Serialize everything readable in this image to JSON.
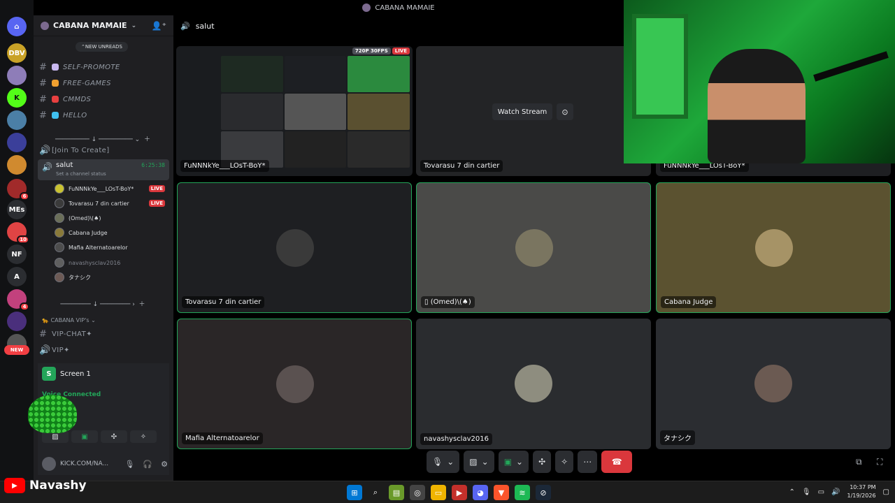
{
  "window": {
    "title": "CABANA MAMAIE",
    "title_icon": "server-avatar"
  },
  "rail": {
    "items": [
      {
        "name": "discord-home",
        "text": "⌂",
        "color": "#5865f2",
        "badge": ""
      },
      {
        "name": "server-dbv",
        "text": "DBV",
        "color": "#c9a227",
        "badge": ""
      },
      {
        "name": "server-anime",
        "text": "",
        "color": "#8e7db8",
        "badge": ""
      },
      {
        "name": "server-kick",
        "text": "K",
        "color": "#53fc18",
        "badge": ""
      },
      {
        "name": "server-globe",
        "text": "",
        "color": "#4b7fa6",
        "badge": ""
      },
      {
        "name": "server-drop",
        "text": "",
        "color": "#3b3f9a",
        "badge": ""
      },
      {
        "name": "server-char",
        "text": "",
        "color": "#d08a2f",
        "badge": ""
      },
      {
        "name": "server-red",
        "text": "",
        "color": "#a12a2a",
        "badge": "6"
      },
      {
        "name": "server-mes",
        "text": "MEs",
        "color": "#2b2d31",
        "badge": ""
      },
      {
        "name": "server-cs",
        "text": "",
        "color": "#e04444",
        "badge": "10"
      },
      {
        "name": "server-nf",
        "text": "NF",
        "color": "#2b2d31",
        "badge": ""
      },
      {
        "name": "server-a",
        "text": "A",
        "color": "#2b2d31",
        "badge": ""
      },
      {
        "name": "server-pink",
        "text": "",
        "color": "#c2417d",
        "badge": "4"
      },
      {
        "name": "server-purple",
        "text": "",
        "color": "#4a2f7c",
        "badge": ""
      },
      {
        "name": "server-last",
        "text": "",
        "color": "#555",
        "badge": ""
      }
    ],
    "new_label": "NEW"
  },
  "sidebar": {
    "guild_name": "CABANA MAMAIE",
    "unreads_label": "NEW UNREADS",
    "channels": [
      {
        "name": "SELF-PROMOTE",
        "color": "#c9b8f0"
      },
      {
        "name": "FREE-GAMES",
        "color": "#f0a030"
      },
      {
        "name": "CMMDS",
        "color": "#e84040"
      },
      {
        "name": "HELLO",
        "color": "#40c0f0"
      }
    ],
    "join_to_create": "[Join To Create]",
    "voice_channel": {
      "name": "salut",
      "time": "6:25:38",
      "status": "Set a channel status"
    },
    "members": [
      {
        "name": "FuNNNkYe___LOsT-BoY*",
        "live": "LIVE",
        "avatar": "#c9c230",
        "dim": false
      },
      {
        "name": "Tovarasu 7 din cartier",
        "live": "LIVE",
        "avatar": "#3b3b3b",
        "dim": false
      },
      {
        "name": "(Omed)\\(♠)",
        "live": "",
        "avatar": "#6b6f59",
        "dim": false
      },
      {
        "name": "Cabana Judge",
        "live": "",
        "avatar": "#8a7a3a",
        "dim": false
      },
      {
        "name": "Mafia Alternatoarelor",
        "live": "",
        "avatar": "#4d4d4d",
        "dim": false
      },
      {
        "name": "navashysclav2016",
        "live": "",
        "avatar": "#5f5f5f",
        "dim": true
      },
      {
        "name": "タナシク",
        "live": "",
        "avatar": "#6d5a55",
        "dim": false
      }
    ],
    "category": "CABANA VIP's",
    "vip_channels": [
      "VIP-CHAT✦",
      "VIP✦"
    ]
  },
  "user_panel": {
    "screen_label": "Screen 1",
    "voice_connected": "Voice Connected",
    "username": "KICK.COM/NA..."
  },
  "main": {
    "channel_name": "salut",
    "quality": "720P 30FPS",
    "live": "LIVE",
    "watch_stream": "Watch Stream",
    "tiles": [
      {
        "label": "FuNNNkYe___LOsT-BoY*",
        "bg": "#1a1c1f",
        "avatar": ""
      },
      {
        "label": "Tovarasu 7 din cartier",
        "bg": "#232426",
        "avatar": ""
      },
      {
        "label": "FuNNNkYe___LOsT-BoY*",
        "bg": "#1e1f22",
        "avatar": ""
      },
      {
        "label": "Tovarasu 7 din cartier",
        "bg": "#1e1f22",
        "avatar": "#3a3a3a"
      },
      {
        "label": "(Omed)\\(♠)",
        "bg": "#4a4a48",
        "avatar": "#7a7560"
      },
      {
        "label": "Cabana Judge",
        "bg": "#5b5230",
        "avatar": "#a69366"
      },
      {
        "label": "Mafia Alternatoarelor",
        "bg": "#2a2627",
        "avatar": "#5a5150"
      },
      {
        "label": "navashysclav2016",
        "bg": "#2a2c2f",
        "avatar": "#8e8d7f"
      },
      {
        "label": "タナシク",
        "bg": "#2b2d31",
        "avatar": "#6b5a52"
      }
    ]
  },
  "brand": {
    "name": "Navashy"
  },
  "taskbar": {
    "time": "10:37 PM",
    "date": "1/19/2026"
  }
}
